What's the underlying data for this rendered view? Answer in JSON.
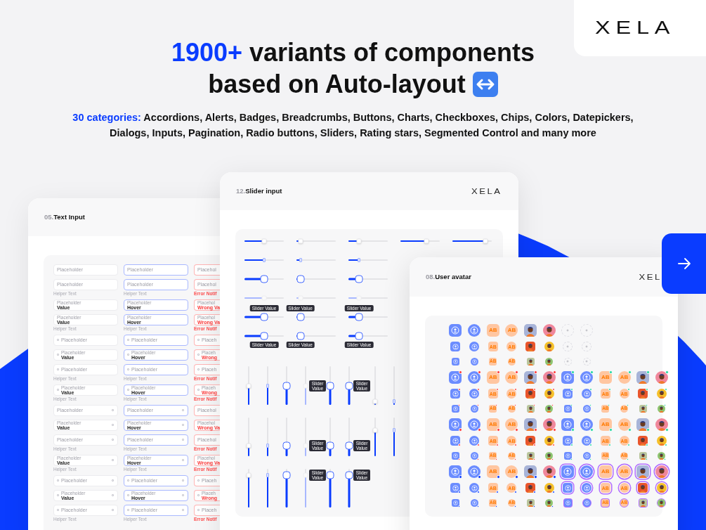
{
  "brand": {
    "logo": "XELA"
  },
  "headline": {
    "highlight": "1900+",
    "line1": " variants of components",
    "line2": "based on Auto-layout"
  },
  "subtitle": {
    "highlight": "30 categories:",
    "text": " Accordions, Alerts, Badges, Breadcrumbs, Buttons, Charts, Checkboxes, Chips, Colors, Datepickers, Dialogs, Inputs, Pagination, Radio buttons, Sliders, Rating stars, Segmented Control and many more"
  },
  "text_input_card": {
    "number": "05.",
    "title": "Text Input",
    "columns": [
      {
        "kind": "default",
        "fields": [
          {
            "kind": "plain",
            "label": "Placeholder"
          },
          {
            "kind": "plain",
            "label": "Placeholder",
            "helper": "Helper Text"
          },
          {
            "kind": "plain",
            "label": "Placeholder",
            "value": "Value"
          },
          {
            "kind": "plain",
            "label": "Placeholder",
            "value": "Value",
            "helper": "Helper Text"
          },
          {
            "kind": "icon-left",
            "label": "Placeholder"
          },
          {
            "kind": "icon-left",
            "label": "Placeholder",
            "value": "Value"
          },
          {
            "kind": "icon-left",
            "label": "Placeholder",
            "helper": "Helper Text"
          },
          {
            "kind": "icon-left",
            "label": "Placeholder",
            "value": "Value",
            "helper": "Helper Text"
          },
          {
            "kind": "icon-right",
            "label": "Placeholder"
          },
          {
            "kind": "icon-right",
            "label": "Placeholder",
            "value": "Value"
          },
          {
            "kind": "icon-right",
            "label": "Placeholder",
            "helper": "Helper Text"
          },
          {
            "kind": "icon-right",
            "label": "Placeholder",
            "value": "Value",
            "helper": "Helper Text"
          },
          {
            "kind": "icon-both",
            "label": "Placeholder"
          },
          {
            "kind": "icon-both",
            "label": "Placeholder",
            "value": "Value"
          },
          {
            "kind": "icon-both",
            "label": "Placeholder",
            "helper": "Helper Text"
          }
        ]
      },
      {
        "kind": "hover",
        "fields": [
          {
            "kind": "plain",
            "label": "Placeholder"
          },
          {
            "kind": "plain",
            "label": "Placeholder",
            "helper": "Helper Text"
          },
          {
            "kind": "plain",
            "label": "Placeholder",
            "value": "Hover"
          },
          {
            "kind": "plain",
            "label": "Placeholder",
            "value": "Hover",
            "helper": "Helper Text"
          },
          {
            "kind": "icon-left",
            "label": "Placeholder"
          },
          {
            "kind": "icon-left",
            "label": "Placeholder",
            "value": "Hover"
          },
          {
            "kind": "icon-left",
            "label": "Placeholder",
            "helper": "Helper Text"
          },
          {
            "kind": "icon-left",
            "label": "Placeholder",
            "value": "Hover",
            "helper": "Helper Text"
          },
          {
            "kind": "icon-right",
            "label": "Placeholder"
          },
          {
            "kind": "icon-right",
            "label": "Placeholder",
            "value": "Hover"
          },
          {
            "kind": "icon-right",
            "label": "Placeholder",
            "helper": "Helper Text"
          },
          {
            "kind": "icon-right",
            "label": "Placeholder",
            "value": "Hover",
            "helper": "Helper Text"
          },
          {
            "kind": "icon-both",
            "label": "Placeholder"
          },
          {
            "kind": "icon-both",
            "label": "Placeholder",
            "value": "Hover"
          },
          {
            "kind": "icon-both",
            "label": "Placeholder",
            "helper": "Helper Text"
          }
        ]
      },
      {
        "kind": "error",
        "fields": [
          {
            "kind": "plain",
            "label": "Placehol"
          },
          {
            "kind": "plain",
            "label": "Placehol",
            "helper": "Error Notif"
          },
          {
            "kind": "plain",
            "label": "Placehol",
            "value": "Wrong Va"
          },
          {
            "kind": "plain",
            "label": "Placehol",
            "value": "Wrong Va",
            "helper": "Error Notif"
          },
          {
            "kind": "icon-left",
            "label": "Placeh"
          },
          {
            "kind": "icon-left",
            "label": "Placeh",
            "value": "Wrong"
          },
          {
            "kind": "icon-left",
            "label": "Placeh",
            "helper": "Error Notif"
          },
          {
            "kind": "icon-left",
            "label": "Placeh",
            "value": "Wrong",
            "helper": "Error Notif"
          },
          {
            "kind": "icon-right",
            "label": "Placehol"
          },
          {
            "kind": "icon-right",
            "label": "Placehol",
            "value": "Wrong Va"
          },
          {
            "kind": "icon-right",
            "label": "Placehol",
            "helper": "Error Notif"
          },
          {
            "kind": "icon-right",
            "label": "Placehol",
            "value": "Wrong Va",
            "helper": "Error Notif"
          },
          {
            "kind": "icon-both",
            "label": "Placeh"
          },
          {
            "kind": "icon-both",
            "label": "Placeh",
            "value": "Wrong"
          },
          {
            "kind": "icon-both",
            "label": "Placeh",
            "helper": "Error Notif"
          }
        ]
      }
    ]
  },
  "slider_card": {
    "number": "12.",
    "title": "Slider input",
    "logo": "XELA",
    "horizontal_rows": [
      {
        "kind": "square",
        "sliders": [
          {
            "level": 0.5
          },
          {
            "level": 0.1
          },
          {
            "level": 0.27
          },
          {
            "level": 0.66
          },
          {
            "level": 0.84
          }
        ]
      },
      {
        "kind": "grip",
        "sliders": [
          {
            "level": 0.5
          },
          {
            "level": 0.1
          },
          {
            "level": 0.27
          }
        ]
      },
      {
        "kind": "round",
        "sliders": [
          {
            "level": 0.5
          },
          {
            "level": 0.1
          },
          {
            "level": 0.27
          }
        ]
      },
      {
        "kind": "disabled",
        "sliders": [
          {
            "level": 0.5
          },
          {
            "level": 0.1
          },
          {
            "level": 0.27
          }
        ]
      },
      {
        "kind": "tooltip-above",
        "sliders": [
          {
            "level": 0.5,
            "tooltip": "Slider Value"
          },
          {
            "level": 0.1,
            "tooltip": "Slider Value"
          },
          {
            "level": 0.27,
            "tooltip": "Slider Value"
          }
        ]
      },
      {
        "kind": "tooltip-below",
        "sliders": [
          {
            "level": 0.5,
            "tooltip": "Slider Value"
          },
          {
            "level": 0.1,
            "tooltip": "Slider Value"
          },
          {
            "level": 0.27,
            "tooltip": "Slider Value"
          }
        ]
      }
    ],
    "vertical_groups": [
      {
        "sliders": [
          {
            "kind": "square",
            "level": 0.5
          },
          {
            "kind": "grip",
            "level": 0.5
          },
          {
            "kind": "round",
            "level": 0.5
          },
          {
            "kind": "disabled",
            "level": 0.5
          },
          {
            "kind": "tooltip-left",
            "level": 0.5,
            "tooltip": "Slider Value"
          },
          {
            "kind": "tooltip-right",
            "level": 0.5,
            "tooltip": "Slider Value"
          },
          {
            "kind": "square",
            "level": 0.1
          },
          {
            "kind": "grip",
            "level": 0.1
          }
        ]
      },
      {
        "sliders": [
          {
            "kind": "square",
            "level": 0.27
          },
          {
            "kind": "grip",
            "level": 0.27
          },
          {
            "kind": "round",
            "level": 0.27
          },
          {
            "kind": "disabled",
            "level": 0.27
          },
          {
            "kind": "tooltip-left",
            "level": 0.27,
            "tooltip": "Slider Value"
          },
          {
            "kind": "tooltip-right",
            "level": 0.27,
            "tooltip": "Slider Value"
          },
          {
            "kind": "square",
            "level": 0.67
          },
          {
            "kind": "grip",
            "level": 0.67
          }
        ]
      },
      {
        "sliders": [
          {
            "kind": "square",
            "level": 0.84
          },
          {
            "kind": "grip",
            "level": 0.84
          },
          {
            "kind": "round",
            "level": 0.84
          },
          {
            "kind": "disabled",
            "level": 0.84
          },
          {
            "kind": "tooltip-left",
            "level": 0.84,
            "tooltip": "Slider Value"
          },
          {
            "kind": "tooltip-right",
            "level": 0.84,
            "tooltip": "Slider Value"
          }
        ]
      }
    ]
  },
  "avatar_card": {
    "number": "08.",
    "title": "User avatar",
    "logo": "XEL",
    "rows": [
      {
        "kind": "large",
        "items": [
          {
            "kind": "icon-square"
          },
          {
            "kind": "icon-circle"
          },
          {
            "kind": "initials-square",
            "text": "AB"
          },
          {
            "kind": "initials-circle",
            "text": "AB"
          },
          {
            "kind": "photo-square",
            "color": "#a8b4d8"
          },
          {
            "kind": "photo-circle",
            "color": "#f0879b"
          },
          {
            "kind": "add"
          },
          {
            "kind": "add"
          }
        ]
      },
      {
        "kind": "medium",
        "items": [
          {
            "kind": "icon-square"
          },
          {
            "kind": "icon-circle"
          },
          {
            "kind": "initials-square",
            "text": "AB"
          },
          {
            "kind": "initials-circle",
            "text": "AB"
          },
          {
            "kind": "photo-square",
            "color": "#e9552c"
          },
          {
            "kind": "photo-circle",
            "color": "#f5c02a"
          },
          {
            "kind": "add"
          },
          {
            "kind": "add"
          }
        ]
      },
      {
        "kind": "small",
        "items": [
          {
            "kind": "icon-square"
          },
          {
            "kind": "icon-circle"
          },
          {
            "kind": "initials-square",
            "text": "AB"
          },
          {
            "kind": "initials-circle",
            "text": "AB"
          },
          {
            "kind": "photo-square",
            "color": "#b9c59c"
          },
          {
            "kind": "photo-circle",
            "color": "#8ec46f"
          },
          {
            "kind": "add"
          },
          {
            "kind": "add"
          }
        ]
      },
      {
        "kind": "large",
        "items": [
          {
            "kind": "icon-square",
            "count_badge": true
          },
          {
            "kind": "icon-circle",
            "count_badge": true
          },
          {
            "kind": "initials-square",
            "text": "AB",
            "count_badge": true
          },
          {
            "kind": "initials-circle",
            "text": "AB",
            "count_badge": true
          },
          {
            "kind": "photo-square",
            "color": "#a8b4d8",
            "count_badge": true
          },
          {
            "kind": "photo-circle",
            "color": "#f0879b",
            "count_badge": true
          },
          {
            "kind": "icon-square",
            "online": true
          },
          {
            "kind": "icon-circle",
            "online": true
          },
          {
            "kind": "initials-square",
            "text": "AB",
            "online": true
          },
          {
            "kind": "initials-circle",
            "text": "AB",
            "online": true
          },
          {
            "kind": "photo-square",
            "color": "#a8b4d8",
            "online": true
          },
          {
            "kind": "photo-circle",
            "color": "#f0879b",
            "online": true
          }
        ]
      },
      {
        "kind": "medium",
        "items": [
          {
            "kind": "icon-square",
            "count_badge": true
          },
          {
            "kind": "icon-circle",
            "count_badge": true
          },
          {
            "kind": "initials-square",
            "text": "AB",
            "count_badge": true
          },
          {
            "kind": "initials-circle",
            "text": "AB",
            "count_badge": true
          },
          {
            "kind": "photo-square",
            "color": "#e9552c",
            "count_badge": true
          },
          {
            "kind": "photo-circle",
            "color": "#f5c02a",
            "count_badge": true
          },
          {
            "kind": "icon-square",
            "online": true
          },
          {
            "kind": "icon-circle",
            "online": true
          },
          {
            "kind": "initials-square",
            "text": "AB",
            "online": true
          },
          {
            "kind": "initials-circle",
            "text": "AB",
            "online": true
          },
          {
            "kind": "photo-square",
            "color": "#e9552c",
            "online": true
          },
          {
            "kind": "photo-circle",
            "color": "#f5c02a",
            "online": true
          }
        ]
      },
      {
        "kind": "small",
        "items": [
          {
            "kind": "icon-square",
            "count_badge": true
          },
          {
            "kind": "icon-circle",
            "count_badge": true
          },
          {
            "kind": "initials-square",
            "text": "AB",
            "count_badge": true
          },
          {
            "kind": "initials-circle",
            "text": "AB",
            "count_badge": true
          },
          {
            "kind": "photo-square",
            "color": "#b9c59c",
            "count_badge": true
          },
          {
            "kind": "photo-circle",
            "color": "#8ec46f",
            "count_badge": true
          },
          {
            "kind": "icon-square",
            "online": true
          },
          {
            "kind": "icon-circle",
            "online": true
          },
          {
            "kind": "initials-square",
            "text": "AB",
            "online": true
          },
          {
            "kind": "initials-circle",
            "text": "AB",
            "online": true
          },
          {
            "kind": "photo-square",
            "color": "#b9c59c",
            "online": true
          },
          {
            "kind": "photo-circle",
            "color": "#8ec46f",
            "online": true
          }
        ]
      },
      {
        "kind": "large-bottom",
        "items": [
          {
            "kind": "icon-square",
            "count_badge": true
          },
          {
            "kind": "icon-circle",
            "count_badge": true
          },
          {
            "kind": "initials-square",
            "text": "AB",
            "count_badge": true
          },
          {
            "kind": "initials-circle",
            "text": "AB",
            "count_badge": true
          },
          {
            "kind": "photo-square",
            "color": "#a8b4d8",
            "count_badge": true
          },
          {
            "kind": "photo-circle",
            "color": "#f0879b",
            "count_badge": true
          },
          {
            "kind": "icon-square",
            "online": true
          },
          {
            "kind": "icon-circle",
            "online": true
          },
          {
            "kind": "initials-square",
            "text": "AB",
            "online": true
          },
          {
            "kind": "initials-circle",
            "text": "AB",
            "online": true
          },
          {
            "kind": "photo-square",
            "color": "#a8b4d8",
            "online": true
          },
          {
            "kind": "photo-circle",
            "color": "#f0879b",
            "online": true
          }
        ]
      },
      {
        "kind": "medium-bottom",
        "items": [
          {
            "kind": "icon-square",
            "count_badge": true
          },
          {
            "kind": "icon-circle",
            "count_badge": true
          },
          {
            "kind": "initials-square",
            "text": "AB",
            "count_badge": true
          },
          {
            "kind": "initials-circle",
            "text": "AB",
            "count_badge": true
          },
          {
            "kind": "photo-square",
            "color": "#e9552c",
            "count_badge": true
          },
          {
            "kind": "photo-circle",
            "color": "#f5c02a",
            "count_badge": true
          },
          {
            "kind": "icon-square",
            "online": true
          },
          {
            "kind": "icon-circle",
            "online": true
          },
          {
            "kind": "initials-square",
            "text": "AB",
            "online": true
          },
          {
            "kind": "initials-circle",
            "text": "AB",
            "online": true
          },
          {
            "kind": "photo-square",
            "color": "#e9552c",
            "online": true
          },
          {
            "kind": "photo-circle",
            "color": "#f5c02a",
            "online": true
          }
        ]
      },
      {
        "kind": "small-bottom",
        "items": [
          {
            "kind": "icon-square",
            "count_badge": true
          },
          {
            "kind": "icon-circle",
            "count_badge": true
          },
          {
            "kind": "initials-square",
            "text": "AB",
            "count_badge": true
          },
          {
            "kind": "initials-circle",
            "text": "AB",
            "count_badge": true
          },
          {
            "kind": "photo-square",
            "color": "#b9c59c",
            "count_badge": true
          },
          {
            "kind": "photo-circle",
            "color": "#8ec46f",
            "count_badge": true
          },
          {
            "kind": "icon-square",
            "online": true
          },
          {
            "kind": "icon-circle",
            "online": true
          },
          {
            "kind": "initials-square",
            "text": "AB",
            "online": true
          },
          {
            "kind": "initials-circle",
            "text": "AB",
            "online": true
          },
          {
            "kind": "photo-square",
            "color": "#b9c59c",
            "online": true
          },
          {
            "kind": "photo-circle",
            "color": "#8ec46f",
            "online": true
          }
        ]
      },
      {
        "kind": "large",
        "items": [
          {
            "kind": "icon-square",
            "verified": true
          },
          {
            "kind": "icon-circle",
            "verified": true
          },
          {
            "kind": "initials-square",
            "text": "AB",
            "verified": true
          },
          {
            "kind": "initials-circle",
            "text": "AB",
            "verified": true
          },
          {
            "kind": "photo-square",
            "color": "#a8b4d8",
            "verified": true
          },
          {
            "kind": "photo-circle",
            "color": "#f0879b",
            "verified": true
          },
          {
            "kind": "icon-square",
            "ring": true
          },
          {
            "kind": "icon-circle",
            "ring": true
          },
          {
            "kind": "initials-square",
            "text": "AB",
            "ring": true
          },
          {
            "kind": "initials-circle",
            "text": "AB",
            "ring": true
          },
          {
            "kind": "photo-square",
            "color": "#a8b4d8",
            "ring": true
          },
          {
            "kind": "photo-circle",
            "color": "#f0879b",
            "ring": true
          }
        ]
      },
      {
        "kind": "medium",
        "items": [
          {
            "kind": "icon-square",
            "verified": true
          },
          {
            "kind": "icon-circle",
            "verified": true
          },
          {
            "kind": "initials-square",
            "text": "AB",
            "verified": true
          },
          {
            "kind": "initials-circle",
            "text": "AB",
            "verified": true
          },
          {
            "kind": "photo-square",
            "color": "#e9552c",
            "verified": true
          },
          {
            "kind": "photo-circle",
            "color": "#f5c02a",
            "verified": true
          },
          {
            "kind": "icon-square",
            "ring": true
          },
          {
            "kind": "icon-circle",
            "ring": true
          },
          {
            "kind": "initials-square",
            "text": "AB",
            "ring": true
          },
          {
            "kind": "initials-circle",
            "text": "AB",
            "ring": true
          },
          {
            "kind": "photo-square",
            "color": "#e9552c",
            "ring": true
          },
          {
            "kind": "photo-circle",
            "color": "#f5c02a",
            "ring": true
          }
        ]
      },
      {
        "kind": "small",
        "items": [
          {
            "kind": "icon-square",
            "verified": true
          },
          {
            "kind": "icon-circle",
            "verified": true
          },
          {
            "kind": "initials-square",
            "text": "AB",
            "verified": true
          },
          {
            "kind": "initials-circle",
            "text": "AB",
            "verified": true
          },
          {
            "kind": "photo-square",
            "color": "#b9c59c",
            "verified": true
          },
          {
            "kind": "photo-circle",
            "color": "#8ec46f",
            "verified": true
          },
          {
            "kind": "icon-square",
            "ring": true
          },
          {
            "kind": "icon-circle",
            "ring": true
          },
          {
            "kind": "initials-square",
            "text": "AB",
            "ring": true
          },
          {
            "kind": "initials-circle",
            "text": "AB",
            "ring": true
          },
          {
            "kind": "photo-square",
            "color": "#b9c59c",
            "ring": true
          },
          {
            "kind": "photo-circle",
            "color": "#8ec46f",
            "ring": true
          }
        ]
      }
    ]
  }
}
